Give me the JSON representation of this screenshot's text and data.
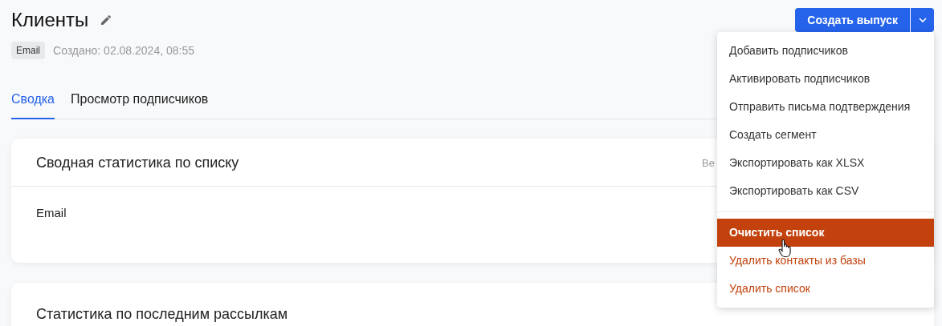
{
  "header": {
    "title": "Клиенты",
    "badge": "Email",
    "created": "Создано: 02.08.2024, 08:55"
  },
  "actions": {
    "primary": "Создать выпуск",
    "menu_expanded": true
  },
  "tabs": [
    {
      "label": "Сводка",
      "selected": true
    },
    {
      "label": "Просмотр подписчиков",
      "selected": false
    }
  ],
  "cards": [
    {
      "title": "Сводная статистика по списку",
      "aside": "Ве",
      "rows": [
        "Email"
      ]
    },
    {
      "title": "Статистика по последним рассылкам"
    }
  ],
  "menu": {
    "groups": [
      [
        {
          "label": "Добавить подписчиков",
          "kind": "normal",
          "selected": false
        },
        {
          "label": "Активировать подписчиков",
          "kind": "normal",
          "selected": false
        },
        {
          "label": "Отправить письма подтверждения",
          "kind": "normal",
          "selected": false
        },
        {
          "label": "Создать сегмент",
          "kind": "normal",
          "selected": false
        },
        {
          "label": "Экспортировать как XLSX",
          "kind": "normal",
          "selected": false
        },
        {
          "label": "Экспортировать как CSV",
          "kind": "normal",
          "selected": false
        }
      ],
      [
        {
          "label": "Очистить список",
          "kind": "danger",
          "selected": true
        },
        {
          "label": "Удалить контакты из базы",
          "kind": "danger",
          "selected": false
        },
        {
          "label": "Удалить список",
          "kind": "danger",
          "selected": false
        }
      ]
    ]
  }
}
